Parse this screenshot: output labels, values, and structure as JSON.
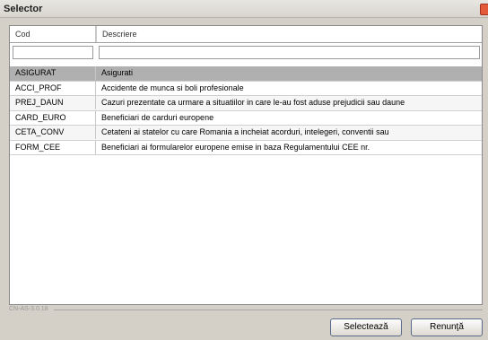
{
  "window": {
    "title": "Selector"
  },
  "columns": {
    "code": "Cod",
    "description": "Descriere"
  },
  "filter": {
    "code": "",
    "description": ""
  },
  "rows": [
    {
      "code": "ASIGURAT",
      "description": "Asigurati"
    },
    {
      "code": "ACCI_PROF",
      "description": "Accidente de munca si boli profesionale"
    },
    {
      "code": "PREJ_DAUN",
      "description": "Cazuri prezentate ca urmare a situatiilor in care le-au fost aduse prejudicii sau daune"
    },
    {
      "code": "CARD_EURO",
      "description": "Beneficiari de carduri europene"
    },
    {
      "code": "CETA_CONV",
      "description": "Cetateni ai statelor cu care Romania a incheiat acorduri, intelegeri, conventii sau"
    },
    {
      "code": "FORM_CEE",
      "description": "Beneficiari ai formularelor europene emise in baza Regulamentului CEE nr."
    }
  ],
  "status": {
    "code": "CN-AS-3.0.18"
  },
  "buttons": {
    "select": "Selectează",
    "cancel": "Renunţă"
  }
}
